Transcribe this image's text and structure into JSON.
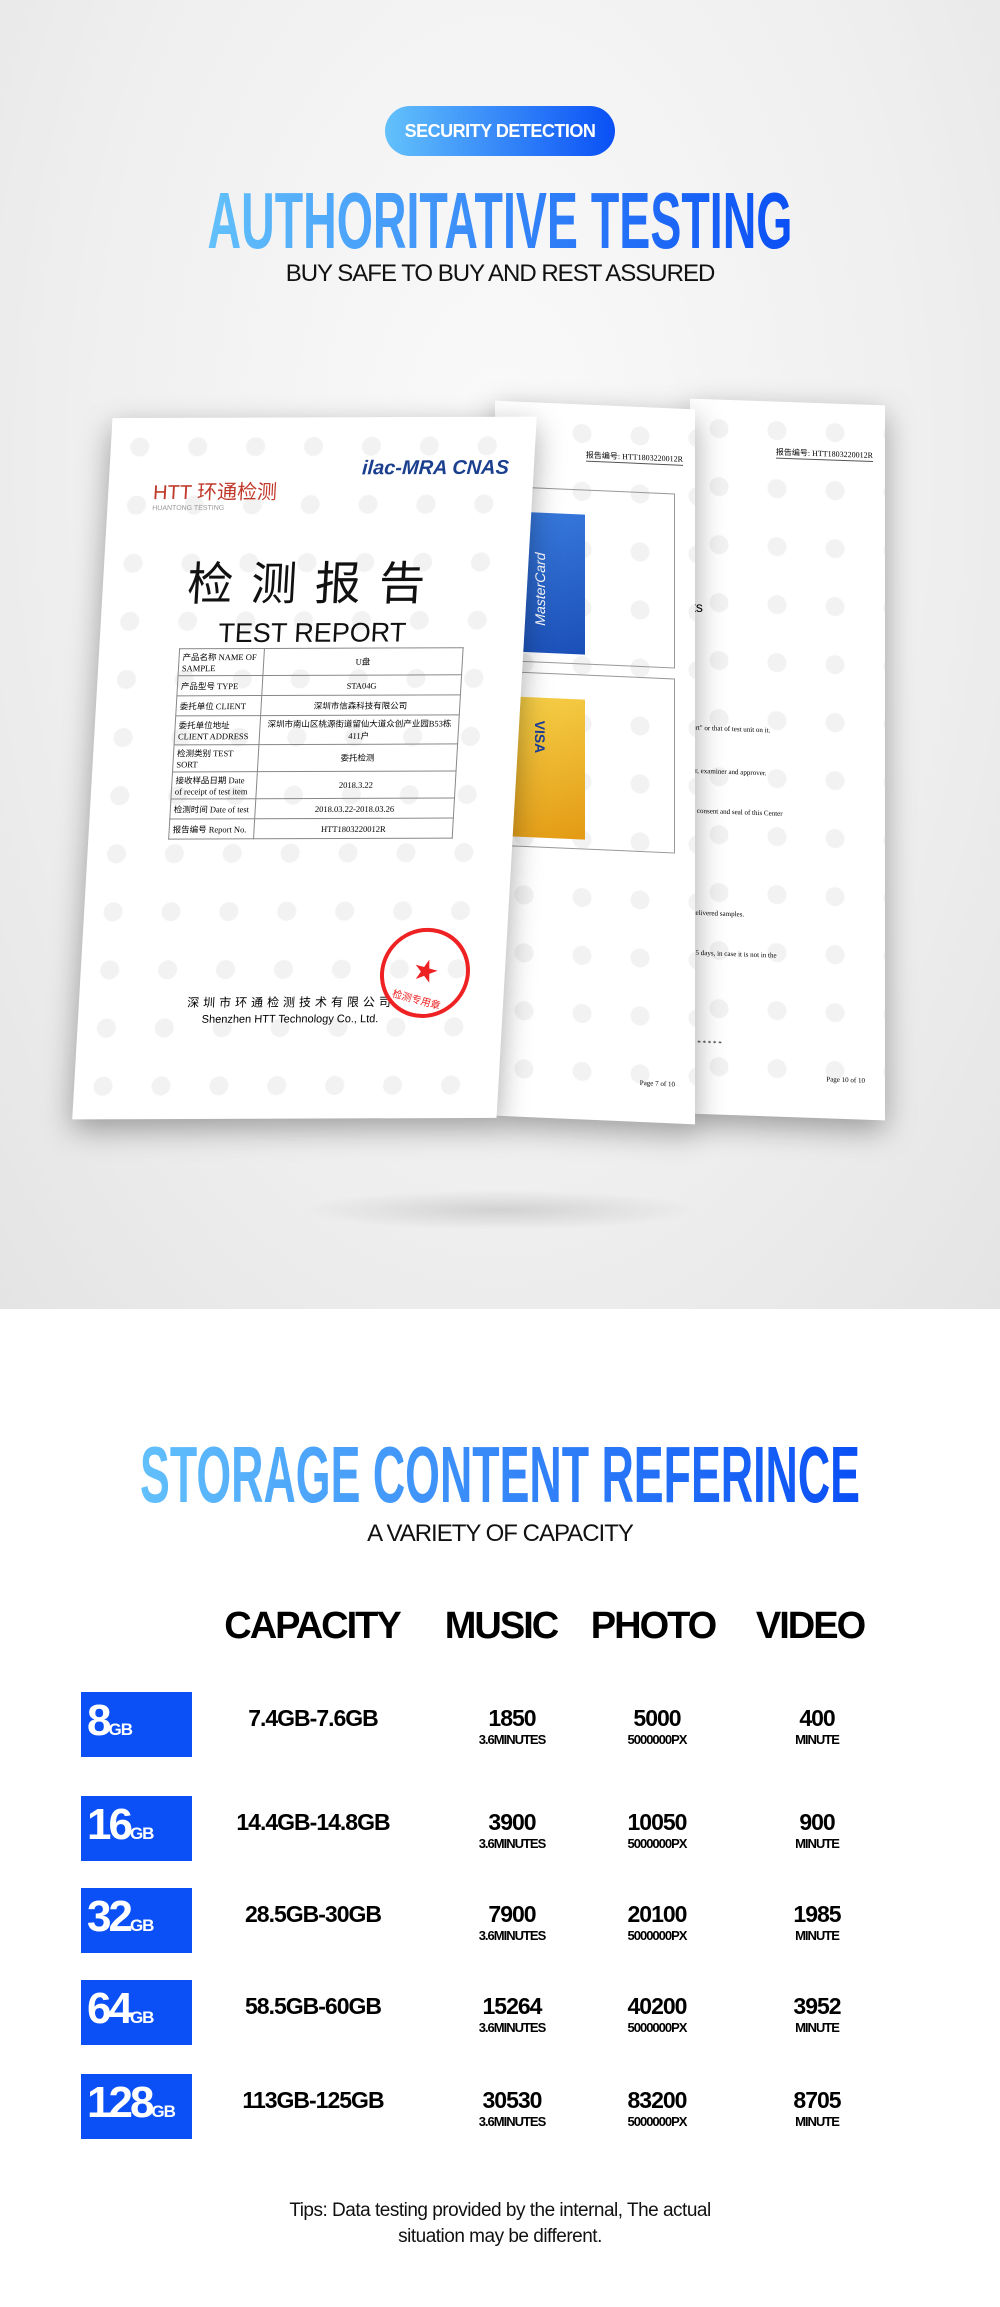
{
  "header": {
    "badge": "SECURITY DETECTION",
    "title": "AUTHORITATIVE TESTING",
    "subtitle": "BUY SAFE TO BUY AND REST ASSURED"
  },
  "report": {
    "logo": "HTT 环通检测",
    "logo_sub": "HUANTONG TESTING",
    "cert_logos": "ilac-MRA CNAS",
    "title_cn": "检测报告",
    "title_en": "TEST REPORT",
    "rows": [
      {
        "label": "产品名称 NAME OF SAMPLE",
        "value": "U盘"
      },
      {
        "label": "产品型号 TYPE",
        "value": "STA04G"
      },
      {
        "label": "委托单位 CLIENT",
        "value": "深圳市信森科技有限公司"
      },
      {
        "label": "委托单位地址 CLIENT ADDRESS",
        "value": "深圳市南山区桃源街道留仙大道众创产业园B53栋411户"
      },
      {
        "label": "检测类别 TEST SORT",
        "value": "委托检测"
      },
      {
        "label": "接收样品日期 Date of receipt of test item",
        "value": "2018.3.22"
      },
      {
        "label": "检测时间 Date of test",
        "value": "2018.03.22-2018.03.26"
      },
      {
        "label": "报告编号 Report No.",
        "value": "HTT1803220012R"
      }
    ],
    "company_cn": "深圳市环通检测技术有限公司",
    "company_en": "Shenzhen HTT Technology Co., Ltd.",
    "stamp": "检测专用章",
    "page2": {
      "report_no": "报告编号: HTT1803220012R",
      "page": "Page 7 of 10",
      "card1": "MasterCard",
      "card2": "VISA"
    },
    "page3": {
      "report_no": "报告编号: HTT1803220012R",
      "page": "Page 10 of 10",
      "lines": [
        "ts",
        "ort\" or that of test unit on it.",
        "er, examiner and approver.",
        "e consent and seal of this Center",
        "delivered samples.",
        "15 days, in case it is not in the",
        "* * * * * *"
      ]
    }
  },
  "storage": {
    "title": "STORAGE CONTENT REFERINCE",
    "subtitle": "A VARIETY OF CAPACITY",
    "columns": [
      "CAPACITY",
      "MUSIC",
      "PHOTO",
      "VIDEO"
    ],
    "rows": [
      {
        "size": "8",
        "unit": "GB",
        "capacity": "7.4GB-7.6GB",
        "music": "1850",
        "music_unit": "3.6MINUTES",
        "photo": "5000",
        "photo_unit": "5000000PX",
        "video": "400",
        "video_unit": "MINUTE"
      },
      {
        "size": "16",
        "unit": "GB",
        "capacity": "14.4GB-14.8GB",
        "music": "3900",
        "music_unit": "3.6MINUTES",
        "photo": "10050",
        "photo_unit": "5000000PX",
        "video": "900",
        "video_unit": "MINUTE"
      },
      {
        "size": "32",
        "unit": "GB",
        "capacity": "28.5GB-30GB",
        "music": "7900",
        "music_unit": "3.6MINUTES",
        "photo": "20100",
        "photo_unit": "5000000PX",
        "video": "1985",
        "video_unit": "MINUTE"
      },
      {
        "size": "64",
        "unit": "GB",
        "capacity": "58.5GB-60GB",
        "music": "15264",
        "music_unit": "3.6MINUTES",
        "photo": "40200",
        "photo_unit": "5000000PX",
        "video": "3952",
        "video_unit": "MINUTE"
      },
      {
        "size": "128",
        "unit": "GB",
        "capacity": "113GB-125GB",
        "music": "30530",
        "music_unit": "3.6MINUTES",
        "photo": "83200",
        "photo_unit": "5000000PX",
        "video": "8705",
        "video_unit": "MINUTE"
      }
    ],
    "tips_line1": "Tips: Data testing provided by the internal, The actual",
    "tips_line2": "situation may be different."
  },
  "colors": {
    "accent": "#0a50f6",
    "gradient_start": "#62c0fb",
    "stamp": "#e22222"
  }
}
